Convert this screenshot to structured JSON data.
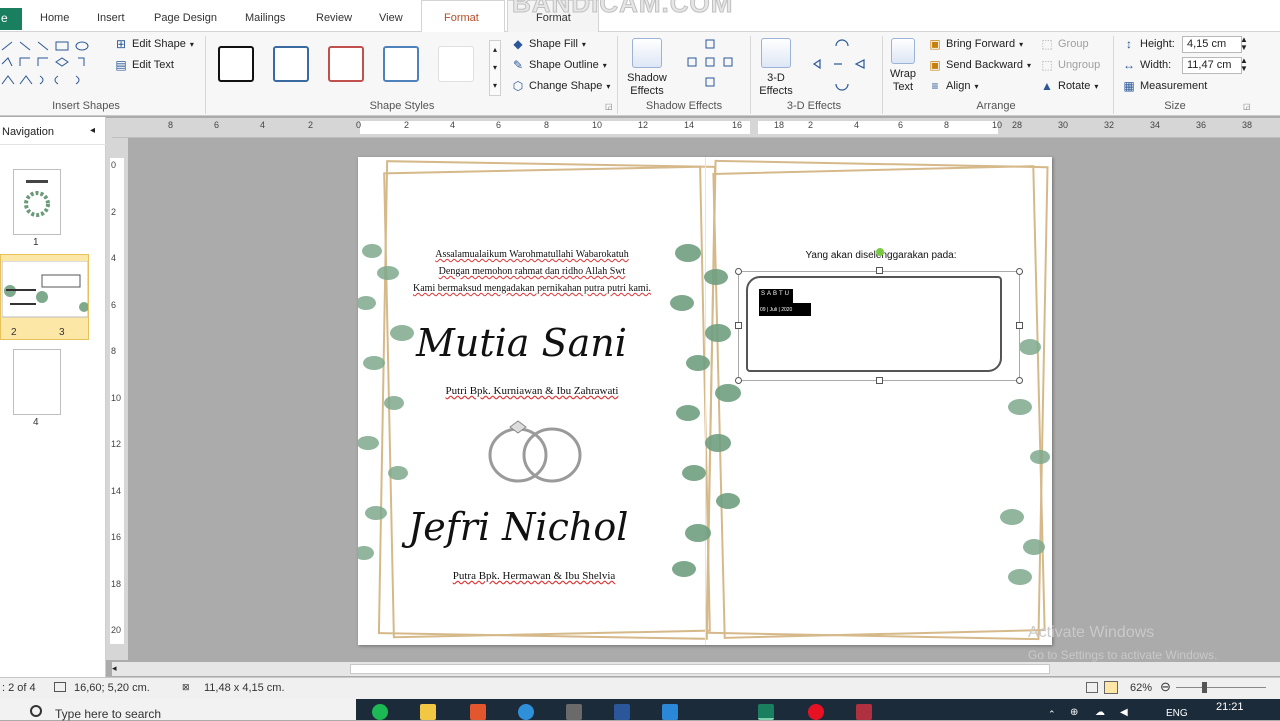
{
  "tabs": {
    "file": "e",
    "items": [
      "Home",
      "Insert",
      "Page Design",
      "Mailings",
      "Review",
      "View"
    ],
    "context": [
      "Format",
      "Format"
    ],
    "watermark": "BANDICAM.COM"
  },
  "ribbon": {
    "insert_shapes": {
      "edit_shape": "Edit Shape",
      "edit_text": "Edit Text",
      "label": "Insert Shapes"
    },
    "shape_styles": {
      "fill": "Shape Fill",
      "outline": "Shape Outline",
      "change": "Change Shape",
      "label": "Shape Styles",
      "swatch_colors": [
        "#111111",
        "#3b6aa0",
        "#c0504d",
        "#4f81bd",
        "#d9d9d9"
      ]
    },
    "shadow": {
      "button": "Shadow\nEffects",
      "label": "Shadow Effects"
    },
    "three_d": {
      "button": "3-D\nEffects",
      "label": "3-D Effects"
    },
    "arrange": {
      "wrap": "Wrap\nText",
      "bring_forward": "Bring Forward",
      "send_backward": "Send Backward",
      "align": "Align",
      "group": "Group",
      "ungroup": "Ungroup",
      "rotate": "Rotate",
      "label": "Arrange"
    },
    "size": {
      "height_label": "Height:",
      "height_value": "4,15 cm",
      "width_label": "Width:",
      "width_value": "11,47 cm",
      "measurement": "Measurement",
      "label": "Size"
    }
  },
  "nav": {
    "title": "Navigation",
    "pages": [
      "1",
      "2",
      "3",
      "4"
    ]
  },
  "ruler": {
    "h_ticks": [
      "8",
      "6",
      "4",
      "2",
      "0",
      "2",
      "4",
      "6",
      "8",
      "10",
      "12",
      "14",
      "16",
      "18",
      "2",
      "4",
      "6",
      "8",
      "10",
      "28",
      "30",
      "32",
      "34",
      "36",
      "38"
    ],
    "v_ticks": [
      "0",
      "2",
      "4",
      "6",
      "8",
      "10",
      "12",
      "14",
      "16",
      "18",
      "20"
    ]
  },
  "page": {
    "greeting": [
      "Assalamualaikum Warohmatullahi Wabarokatuh",
      "Dengan memohon rahmat dan ridho Allah Swt",
      "Kami bermaksud mengadakan pernikahan putra putri kami."
    ],
    "bride": "Mutia Sani",
    "bride_parents": "Putri Bpk. Kurniawan & Ibu Zahrawati",
    "groom": "Jefri Nichol",
    "groom_parents": "Putra Bpk. Hermawan & Ibu Shelvia",
    "right_heading": "Yang akan diselenggarakan pada:",
    "day": "SABTU",
    "date": "09 | Juli | 2020"
  },
  "status": {
    "page": "2 of 4",
    "position": "16,60; 5,20 cm.",
    "size": "11,48 x 4,15 cm.",
    "zoom": "62%",
    "activate_title": "Activate Windows",
    "activate_sub": "Go to Settings to activate Windows."
  },
  "taskbar": {
    "search": "Type here to search",
    "lang": "ENG",
    "time": "21:21"
  }
}
